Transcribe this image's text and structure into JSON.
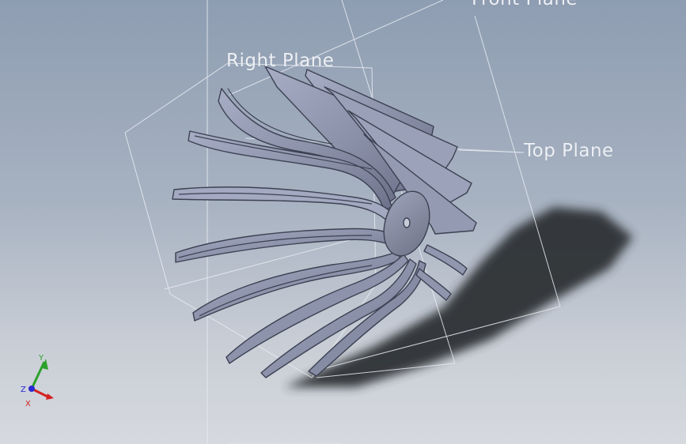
{
  "planes": {
    "front": "Front Plane",
    "right": "Right Plane",
    "top": "Top Plane"
  },
  "triad": {
    "x_label": "X",
    "y_label": "Y",
    "z_label": "Z"
  },
  "colors": {
    "blade_face": "#8e94ad",
    "blade_edge": "#3c4152",
    "shadow": "#2e3034",
    "plane_lines": "#e8ecf2",
    "axis_x": "#d42020",
    "axis_y": "#2aa12a",
    "axis_z": "#2a2ad4"
  }
}
